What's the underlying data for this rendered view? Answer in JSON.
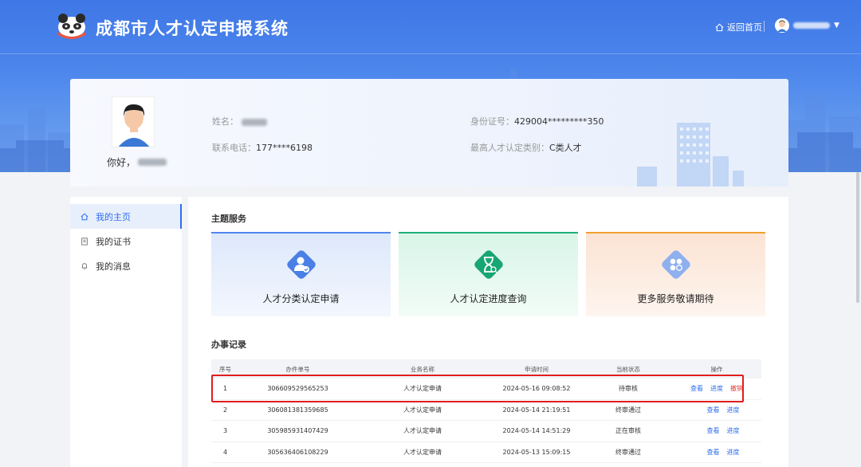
{
  "header": {
    "title": "成都市人才认定申报系统",
    "home_label": "返回首页"
  },
  "profile": {
    "greeting": "你好，",
    "name_label": "姓名：",
    "phone_label": "联系电话：",
    "phone": "177****6198",
    "id_label": "身份证号：",
    "id_number": "429004*********350",
    "level_label": "最高人才认定类别：",
    "level": "C类人才"
  },
  "sidebar": {
    "items": [
      {
        "label": "我的主页",
        "icon": "home-icon",
        "active": true
      },
      {
        "label": "我的证书",
        "icon": "certificate-icon",
        "active": false
      },
      {
        "label": "我的消息",
        "icon": "bell-icon",
        "active": false
      }
    ]
  },
  "services": {
    "title": "主题服务",
    "cards": [
      {
        "label": "人才分类认定申请",
        "icon": "user-check-icon",
        "accent": "#4f86ec"
      },
      {
        "label": "人才认定进度查询",
        "icon": "hourglass-search-icon",
        "accent": "#1db07a"
      },
      {
        "label": "更多服务敬请期待",
        "icon": "grid-icon",
        "accent": "#f0a030"
      }
    ]
  },
  "records": {
    "title": "办事记录",
    "columns": [
      "序号",
      "办件单号",
      "业务名称",
      "申请时间",
      "当前状态",
      "操作"
    ],
    "rows": [
      {
        "no": "1",
        "id": "306609529565253",
        "name": "人才认定申请",
        "time": "2024-05-16 09:08:52",
        "status": "待审核",
        "actions": [
          "查看",
          "进度",
          "撤销"
        ]
      },
      {
        "no": "2",
        "id": "306081381359685",
        "name": "人才认定申请",
        "time": "2024-05-14 21:19:51",
        "status": "终审通过",
        "actions": [
          "查看",
          "进度"
        ]
      },
      {
        "no": "3",
        "id": "305985931407429",
        "name": "人才认定申请",
        "time": "2024-05-14 14:51:29",
        "status": "正在审核",
        "actions": [
          "查看",
          "进度"
        ]
      },
      {
        "no": "4",
        "id": "305636406108229",
        "name": "人才认定申请",
        "time": "2024-05-13 15:09:15",
        "status": "终审通过",
        "actions": [
          "查看",
          "进度"
        ]
      }
    ]
  },
  "colors": {
    "primary": "#2d6df0",
    "danger": "#e53935",
    "highlight_border": "#e11d1d"
  }
}
